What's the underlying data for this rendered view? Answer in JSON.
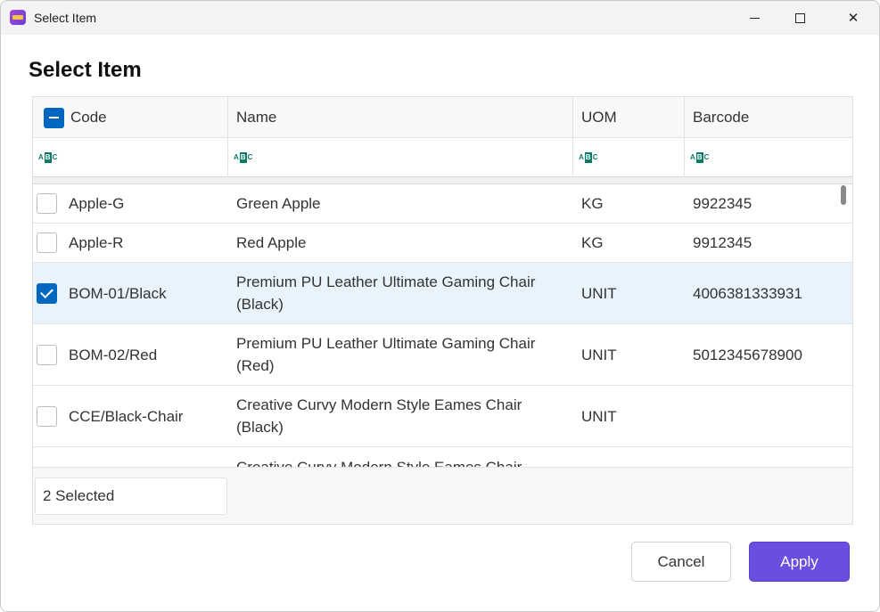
{
  "window": {
    "title": "Select Item",
    "accent": "#6a4ee0"
  },
  "dialog": {
    "heading": "Select Item"
  },
  "grid": {
    "columns": [
      {
        "key": "code",
        "label": "Code"
      },
      {
        "key": "name",
        "label": "Name"
      },
      {
        "key": "uom",
        "label": "UOM"
      },
      {
        "key": "barcode",
        "label": "Barcode"
      }
    ],
    "filter_icon": "abc-text-filter-icon",
    "header_checkbox_state": "indeterminate",
    "rows": [
      {
        "checked": false,
        "code": "Apple-G",
        "name": "Green Apple",
        "uom": "KG",
        "barcode": "9922345"
      },
      {
        "checked": false,
        "code": "Apple-R",
        "name": "Red Apple",
        "uom": "KG",
        "barcode": "9912345"
      },
      {
        "checked": true,
        "code": "BOM-01/Black",
        "name": "Premium PU Leather Ultimate Gaming Chair (Black)",
        "uom": "UNIT",
        "barcode": "4006381333931"
      },
      {
        "checked": false,
        "code": "BOM-02/Red",
        "name": "Premium PU Leather Ultimate Gaming Chair (Red)",
        "uom": "UNIT",
        "barcode": "5012345678900"
      },
      {
        "checked": false,
        "code": "CCE/Black-Chair",
        "name": "Creative Curvy Modern Style Eames Chair (Black)",
        "uom": "UNIT",
        "barcode": ""
      },
      {
        "checked": false,
        "code": "",
        "name": "Creative Curvy Modern Style Eames Chair",
        "uom": "",
        "barcode": ""
      }
    ],
    "selected_count": "2 Selected"
  },
  "buttons": {
    "cancel": "Cancel",
    "apply": "Apply"
  }
}
